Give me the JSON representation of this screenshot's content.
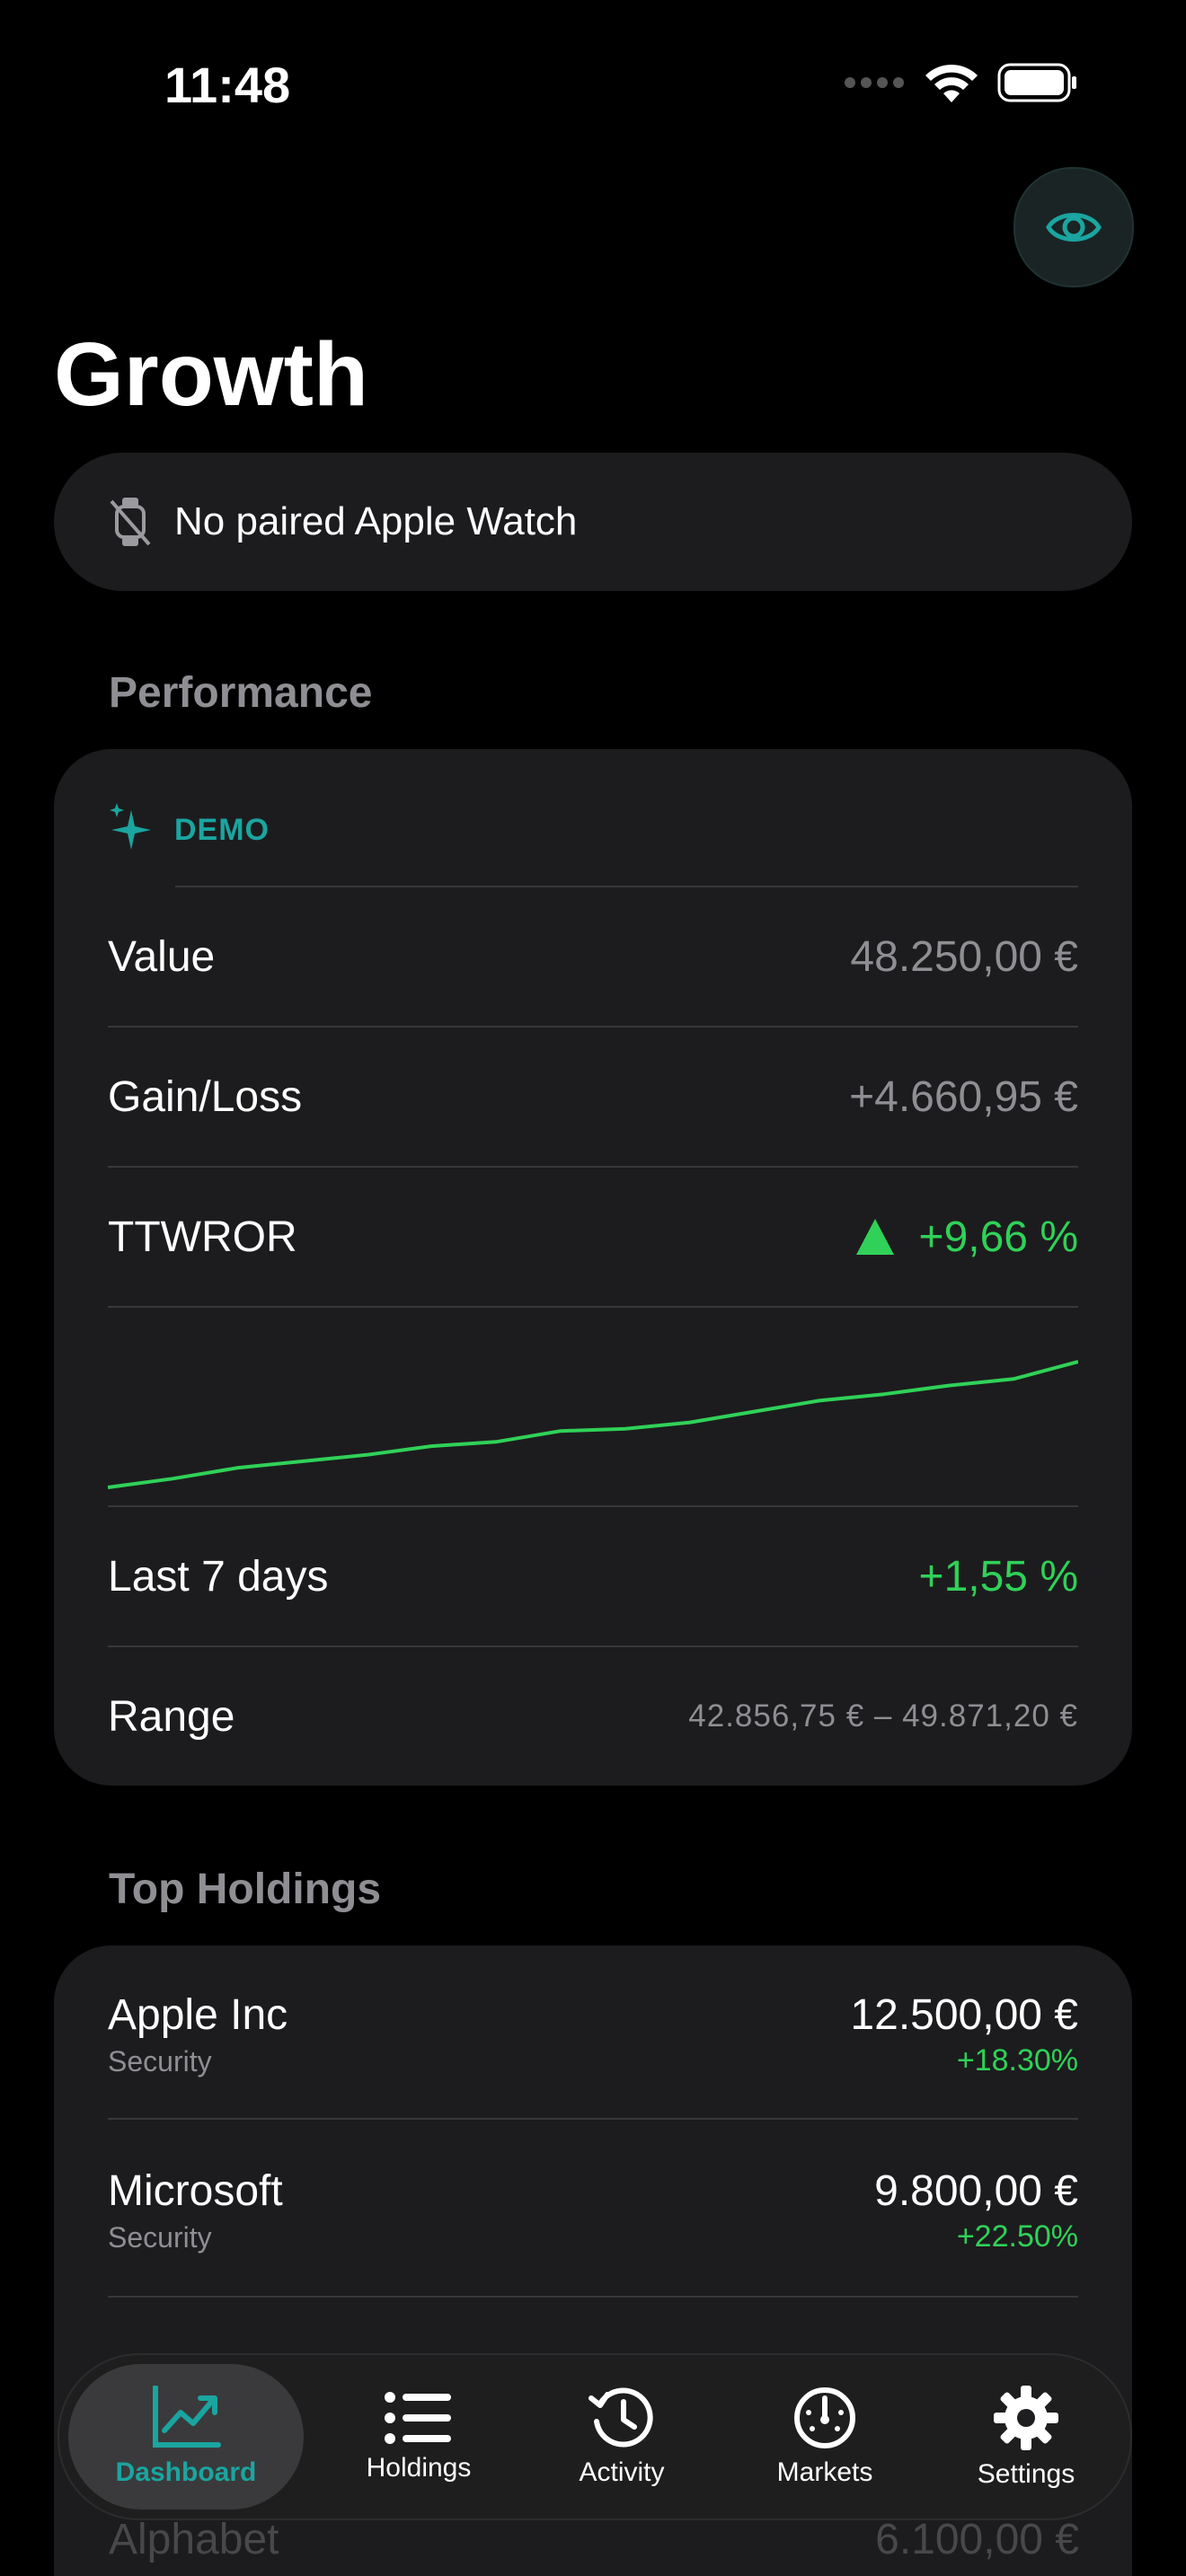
{
  "status_bar": {
    "time": "11:48"
  },
  "header": {
    "title": "Growth"
  },
  "watch": {
    "text": "No paired Apple Watch",
    "icon": "watch-slash-icon"
  },
  "performance": {
    "section_title": "Performance",
    "badge": "DEMO",
    "rows": {
      "value": {
        "label": "Value",
        "value": "48.250,00 €"
      },
      "gain_loss": {
        "label": "Gain/Loss",
        "value": "+4.660,95 €"
      },
      "ttwror": {
        "label": "TTWROR",
        "value": "+9,66 %"
      },
      "last7": {
        "label": "Last 7 days",
        "value": "+1,55 %"
      },
      "range": {
        "label": "Range",
        "value": "42.856,75 € – 49.871,20 €"
      }
    },
    "sparkline": {
      "values": [
        100,
        100.4,
        100.9,
        101.2,
        101.5,
        101.9,
        102.1,
        102.6,
        102.7,
        103.0,
        103.5,
        104.0,
        104.3,
        104.7,
        105.0,
        105.8
      ],
      "color": "#30d158"
    }
  },
  "top_holdings": {
    "section_title": "Top Holdings",
    "items": [
      {
        "name": "Apple Inc",
        "type": "Security",
        "amount": "12.500,00 €",
        "change": "+18.30%"
      },
      {
        "name": "Microsoft",
        "type": "Security",
        "amount": "9.800,00 €",
        "change": "+22.50%"
      }
    ],
    "partial_item": {
      "name": "Alphabet",
      "amount": "6.100,00 €"
    }
  },
  "tabs": [
    {
      "label": "Dashboard",
      "icon": "chart-line-icon",
      "active": true
    },
    {
      "label": "Holdings",
      "icon": "list-icon",
      "active": false
    },
    {
      "label": "Activity",
      "icon": "clock-history-icon",
      "active": false
    },
    {
      "label": "Markets",
      "icon": "gauge-icon",
      "active": false
    },
    {
      "label": "Settings",
      "icon": "gear-icon",
      "active": false
    }
  ],
  "colors": {
    "accent": "#1ba5a0",
    "positive": "#30d158",
    "card": "#1c1c1e",
    "muted": "#8e8e93"
  }
}
